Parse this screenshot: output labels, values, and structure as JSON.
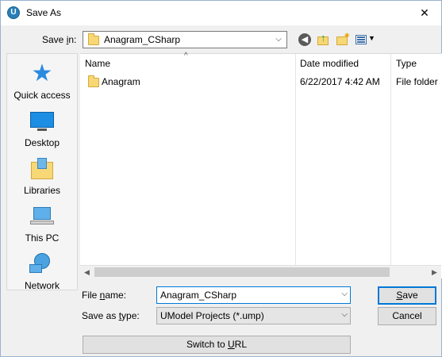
{
  "window": {
    "title": "Save As",
    "close_glyph": "✕"
  },
  "toolbar": {
    "save_in_label": "Save in:",
    "save_in_value": "Anagram_CSharp",
    "icons": [
      "back-icon",
      "up-folder-icon",
      "new-folder-icon",
      "view-menu-icon"
    ]
  },
  "places": [
    {
      "label": "Quick access",
      "icon": "quick-access-star-icon"
    },
    {
      "label": "Desktop",
      "icon": "desktop-icon"
    },
    {
      "label": "Libraries",
      "icon": "libraries-icon"
    },
    {
      "label": "This PC",
      "icon": "this-pc-icon"
    },
    {
      "label": "Network",
      "icon": "network-icon"
    }
  ],
  "filelist": {
    "columns": [
      "Name",
      "Date modified",
      "Type"
    ],
    "rows": [
      {
        "name": "Anagram",
        "date_modified": "6/22/2017 4:42 AM",
        "type": "File folder"
      }
    ]
  },
  "form": {
    "file_name_label": "File name:",
    "file_name_value": "Anagram_CSharp",
    "save_type_label": "Save as type:",
    "save_type_value": "UModel Projects (*.ump)",
    "save_button": "Save",
    "cancel_button": "Cancel",
    "switch_url_button": "Switch to URL"
  },
  "colors": {
    "accent": "#0078d7",
    "folder": "#f8d775",
    "places_bg": "#f5f5f5"
  }
}
